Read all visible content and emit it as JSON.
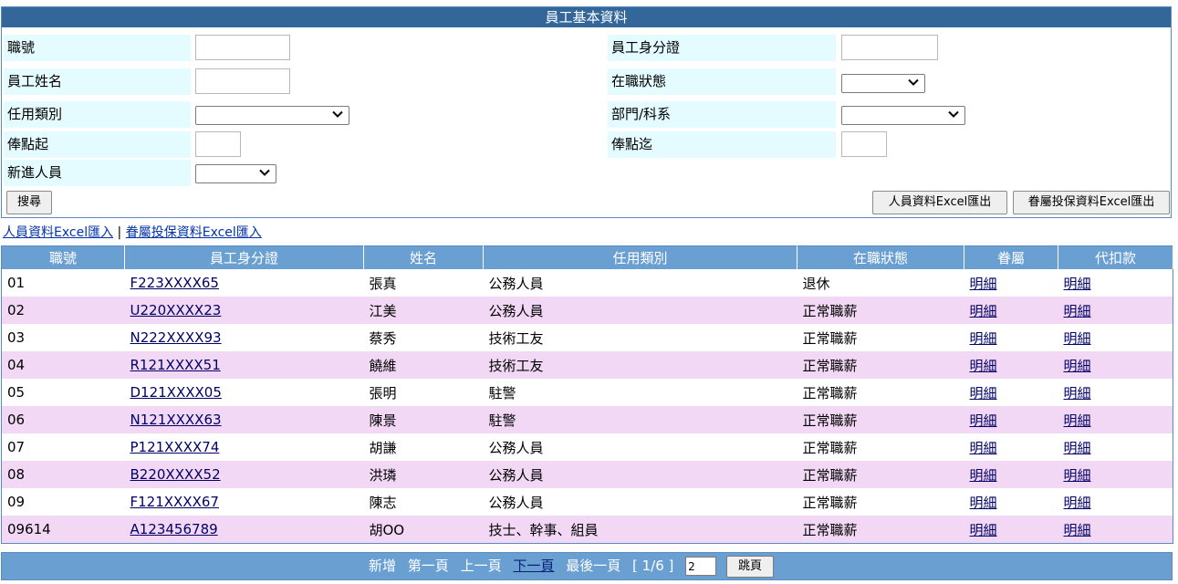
{
  "panel": {
    "title": "員工基本資料",
    "fields": {
      "emp_no": {
        "label": "職號",
        "value": ""
      },
      "id_no": {
        "label": "員工身分證",
        "value": ""
      },
      "name": {
        "label": "員工姓名",
        "value": ""
      },
      "status": {
        "label": "在職狀態",
        "selected": ""
      },
      "category": {
        "label": "任用類別",
        "selected": ""
      },
      "dept": {
        "label": "部門/科系",
        "selected": ""
      },
      "pay_from": {
        "label": "俸點起",
        "value": ""
      },
      "pay_to": {
        "label": "俸點迄",
        "value": ""
      },
      "new_staff": {
        "label": "新進人員",
        "selected": ""
      }
    },
    "search_label": "搜尋",
    "export_staff_label": "人員資料Excel匯出",
    "export_family_label": "眷屬投保資料Excel匯出"
  },
  "links": {
    "import_staff": "人員資料Excel匯入",
    "separator": "|",
    "import_family": "眷屬投保資料Excel匯入"
  },
  "table": {
    "headers": [
      "職號",
      "員工身分證",
      "姓名",
      "任用類別",
      "在職狀態",
      "眷屬",
      "代扣款"
    ],
    "rows": [
      {
        "no": "01",
        "id": "F223XXXX65",
        "name": "張真",
        "category": "公務人員",
        "status": "退休",
        "family": "明細",
        "deduct": "明細"
      },
      {
        "no": "02",
        "id": "U220XXXX23",
        "name": "江美",
        "category": "公務人員",
        "status": "正常職薪",
        "family": "明細",
        "deduct": "明細"
      },
      {
        "no": "03",
        "id": "N222XXXX93",
        "name": "蔡秀",
        "category": "技術工友",
        "status": "正常職薪",
        "family": "明細",
        "deduct": "明細"
      },
      {
        "no": "04",
        "id": "R121XXXX51",
        "name": "饒維",
        "category": "技術工友",
        "status": "正常職薪",
        "family": "明細",
        "deduct": "明細"
      },
      {
        "no": "05",
        "id": "D121XXXX05",
        "name": "張明",
        "category": "駐警",
        "status": "正常職薪",
        "family": "明細",
        "deduct": "明細"
      },
      {
        "no": "06",
        "id": "N121XXXX63",
        "name": "陳景",
        "category": "駐警",
        "status": "正常職薪",
        "family": "明細",
        "deduct": "明細"
      },
      {
        "no": "07",
        "id": "P121XXXX74",
        "name": "胡謙",
        "category": "公務人員",
        "status": "正常職薪",
        "family": "明細",
        "deduct": "明細"
      },
      {
        "no": "08",
        "id": "B220XXXX52",
        "name": "洪璘",
        "category": "公務人員",
        "status": "正常職薪",
        "family": "明細",
        "deduct": "明細"
      },
      {
        "no": "09",
        "id": "F121XXXX67",
        "name": "陳志",
        "category": "公務人員",
        "status": "正常職薪",
        "family": "明細",
        "deduct": "明細"
      },
      {
        "no": "09614",
        "id": "A123456789",
        "name": "胡OO",
        "category": "技士、幹事、組員",
        "status": "正常職薪",
        "family": "明細",
        "deduct": "明細"
      }
    ]
  },
  "pager": {
    "add": "新增",
    "first": "第一頁",
    "prev": "上一頁",
    "next": "下一頁",
    "last": "最後一頁",
    "page_info": "[ 1/6 ]",
    "input_value": "2",
    "jump_label": "跳頁"
  },
  "icons": {
    "dropdown": "chevron-down-icon"
  },
  "colors": {
    "header_bar": "#336699",
    "table_header": "#6a9fd2",
    "label_bg": "#e4fbff",
    "alt_row": "#f2d8f5"
  }
}
